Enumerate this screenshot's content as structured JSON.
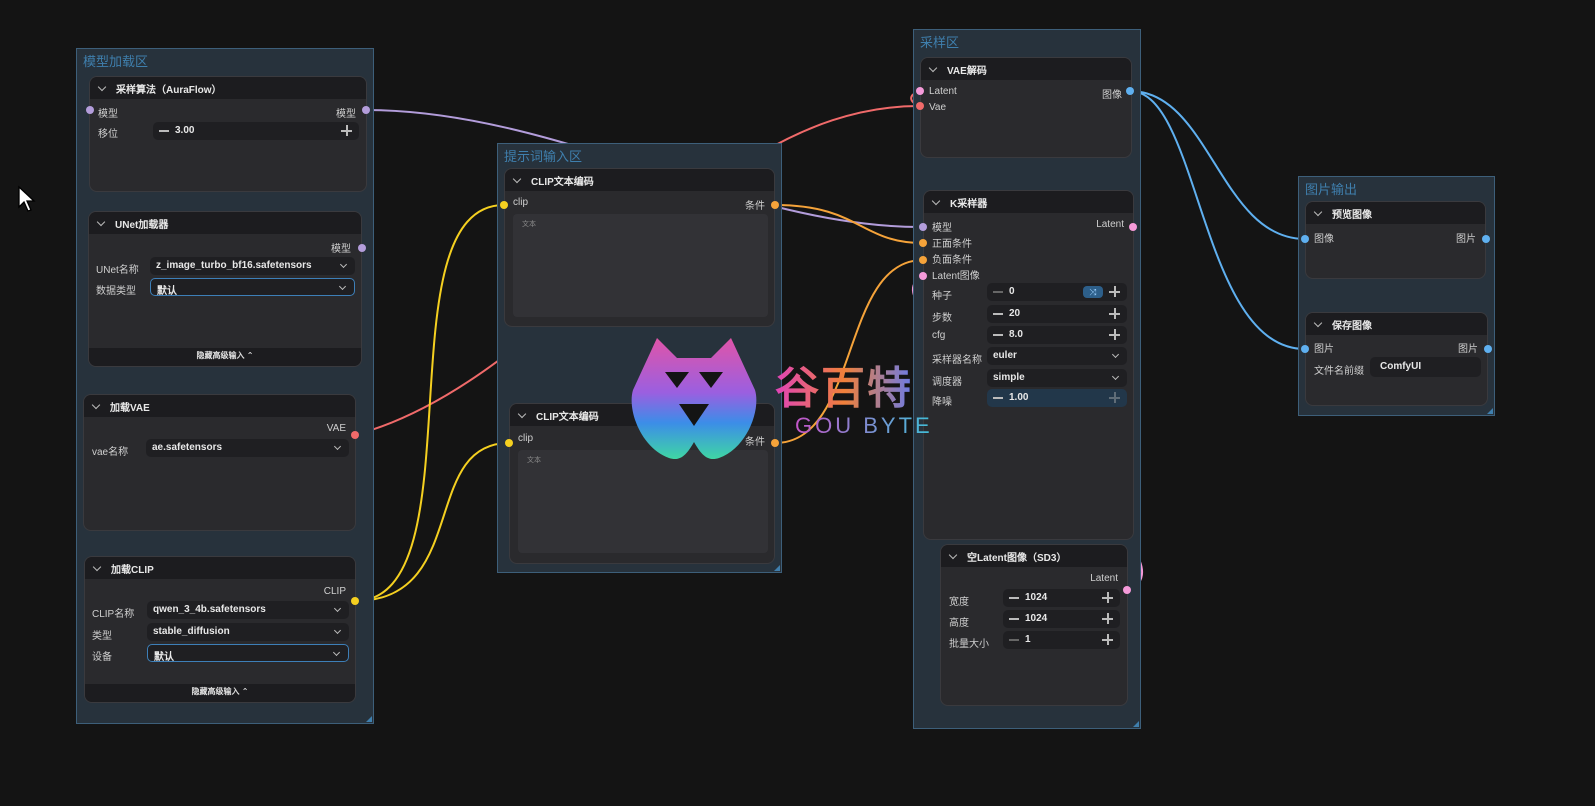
{
  "groups": {
    "model_load": {
      "title": "模型加载区"
    },
    "prompt": {
      "title": "提示词输入区"
    },
    "sampling": {
      "title": "采样区"
    },
    "image_out": {
      "title": "图片输出"
    }
  },
  "nodes": {
    "sampling_algo": {
      "title": "采样算法（AuraFlow）",
      "in_model": "模型",
      "out_model": "模型",
      "shift_label": "移位",
      "shift_value": "3.00"
    },
    "unet_loader": {
      "title": "UNet加载器",
      "out_model": "模型",
      "name_label": "UNet名称",
      "name_value": "z_image_turbo_bf16.safetensors",
      "dtype_label": "数据类型",
      "dtype_value": "默认",
      "footer": "隐藏高级输入"
    },
    "vae_loader": {
      "title": "加载VAE",
      "out_vae": "VAE",
      "name_label": "vae名称",
      "name_value": "ae.safetensors"
    },
    "clip_loader": {
      "title": "加载CLIP",
      "out_clip": "CLIP",
      "name_label": "CLIP名称",
      "name_value": "qwen_3_4b.safetensors",
      "type_label": "类型",
      "type_value": "stable_diffusion",
      "device_label": "设备",
      "device_value": "默认",
      "footer": "隐藏高级输入"
    },
    "clip_encode_1": {
      "title": "CLIP文本编码",
      "in_clip": "clip",
      "out_cond": "条件",
      "text_placeholder": "文本"
    },
    "clip_encode_2": {
      "title": "CLIP文本编码",
      "in_clip": "clip",
      "out_cond": "条件",
      "text_placeholder": "文本"
    },
    "vae_decode": {
      "title": "VAE解码",
      "in_latent": "Latent",
      "in_vae": "Vae",
      "out_image": "图像"
    },
    "ksampler": {
      "title": "K采样器",
      "in_model": "模型",
      "in_pos": "正面条件",
      "in_neg": "负面条件",
      "in_latent": "Latent图像",
      "out_latent": "Latent",
      "seed_label": "种子",
      "seed_value": "0",
      "steps_label": "步数",
      "steps_value": "20",
      "cfg_label": "cfg",
      "cfg_value": "8.0",
      "sampler_label": "采样器名称",
      "sampler_value": "euler",
      "scheduler_label": "调度器",
      "scheduler_value": "simple",
      "denoise_label": "降噪",
      "denoise_value": "1.00"
    },
    "empty_latent": {
      "title": "空Latent图像（SD3）",
      "out_latent": "Latent",
      "width_label": "宽度",
      "width_value": "1024",
      "height_label": "高度",
      "height_value": "1024",
      "batch_label": "批量大小",
      "batch_value": "1"
    },
    "preview_image": {
      "title": "预览图像",
      "in_image": "图像",
      "out_image": "图片"
    },
    "save_image": {
      "title": "保存图像",
      "in_image": "图片",
      "out_image": "图片",
      "prefix_label": "文件名前缀",
      "prefix_value": "ComfyUI"
    }
  },
  "watermark": {
    "brand_cn": "谷百特",
    "brand_en": "GOU BYTE"
  },
  "colors": {
    "model": "#b39ddb",
    "clip": "#f5d020",
    "vae": "#f06a6a",
    "conditioning": "#f5a33a",
    "latent": "#f59ad9",
    "image": "#5fb0f0",
    "group_border": "#3d5f7a"
  },
  "icons": {
    "cursor": "arrow-cursor-icon",
    "collapse": "chevron-down-icon",
    "random": "shuffle-icon"
  }
}
